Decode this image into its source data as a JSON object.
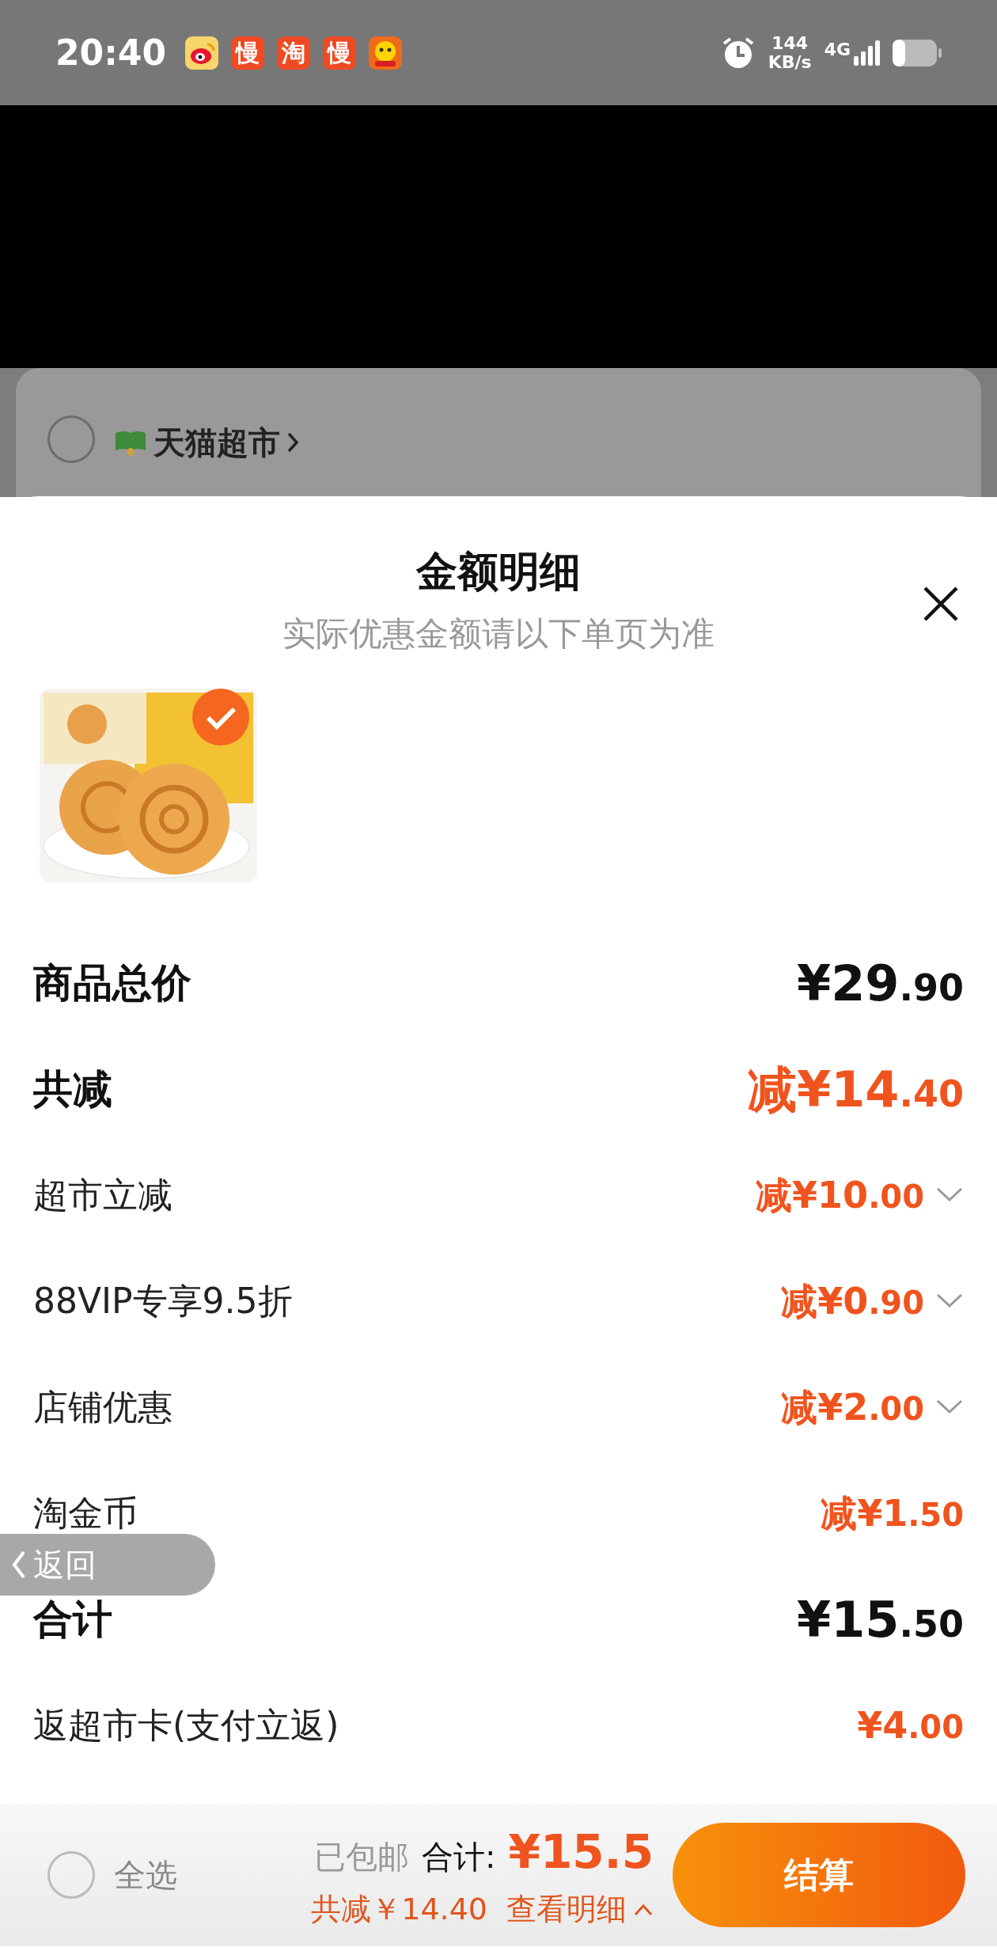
{
  "status_bar": {
    "time": "20:40",
    "apps": [
      {
        "kind": "weibo"
      },
      {
        "kind": "glyph",
        "glyph": "慢"
      },
      {
        "kind": "glyph",
        "glyph": "淘"
      },
      {
        "kind": "glyph",
        "glyph": "慢"
      },
      {
        "kind": "mascot"
      }
    ],
    "speed": "144",
    "speed_unit": "KB/s",
    "network": "4G"
  },
  "background_store": {
    "name": "天猫超市",
    "selected": false
  },
  "sheet": {
    "title": "金额明细",
    "subtitle": "实际优惠金额请以下单页为准",
    "products": [
      {
        "kind": "picture",
        "selected": true
      }
    ],
    "rows": [
      {
        "label": "商品总价",
        "amount": "¥29.90",
        "bold": true,
        "accent": false,
        "expandable": false
      },
      {
        "label": "共减",
        "prefix": "减",
        "amount": "¥14.40",
        "bold": true,
        "accent": true,
        "expandable": false
      },
      {
        "label": "超市立减",
        "prefix": "减",
        "amount": "¥10.00",
        "bold": false,
        "accent": true,
        "expandable": true
      },
      {
        "label": "88VIP专享9.5折",
        "prefix": "减",
        "amount": "¥0.90",
        "bold": false,
        "accent": true,
        "expandable": true
      },
      {
        "label": "店铺优惠",
        "prefix": "减",
        "amount": "¥2.00",
        "bold": false,
        "accent": true,
        "expandable": true
      },
      {
        "label": "淘金币",
        "prefix": "减",
        "amount": "¥1.50",
        "bold": false,
        "accent": true,
        "expandable": false
      },
      {
        "label": "合计",
        "amount": "¥15.50",
        "bold": true,
        "accent": false,
        "expandable": false
      },
      {
        "label": "返超市卡(支付立返)",
        "amount": "¥4.00",
        "bold": false,
        "accent": true,
        "expandable": false
      }
    ]
  },
  "back_button": {
    "label": "返回"
  },
  "bottom_bar": {
    "select_all": {
      "label": "全选",
      "selected": false
    },
    "shipping": "已包邮",
    "total_label": "合计:",
    "total": "¥15.5",
    "discount": "共减￥14.40",
    "details_link": "查看明细",
    "checkout": "结算"
  }
}
